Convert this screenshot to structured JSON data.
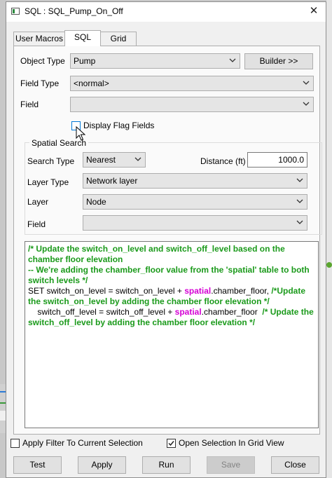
{
  "window": {
    "title": "SQL : SQL_Pump_On_Off"
  },
  "tabs": [
    {
      "label": "User Macros",
      "active": false
    },
    {
      "label": "SQL",
      "active": true
    },
    {
      "label": "Grid",
      "active": false
    }
  ],
  "form": {
    "object_type_label": "Object Type",
    "object_type_value": "Pump",
    "builder_label": "Builder >>",
    "field_type_label": "Field Type",
    "field_type_value": "<normal>",
    "field_label": "Field",
    "field_value": "",
    "display_flag_label": "Display Flag Fields",
    "display_flag_checked": false
  },
  "spatial": {
    "group_title": "Spatial Search",
    "search_type_label": "Search Type",
    "search_type_value": "Nearest",
    "distance_label": "Distance (ft)",
    "distance_value": "1000.0",
    "layer_type_label": "Layer Type",
    "layer_type_value": "Network layer",
    "layer_label": "Layer",
    "layer_value": "Node",
    "field_label": "Field",
    "field_value": ""
  },
  "sql": {
    "c1": "/*  Update the switch_on_level and switch_off_level based on the chamber floor elevation",
    "c2": "-- We're adding the chamber_floor value from the 'spatial' table to both switch levels */",
    "s1a": "SET switch_on_level = switch_on_level + ",
    "s1kw": "spatial",
    "s1b": ".chamber_floor, ",
    "s1c": "/*Update the switch_on_level by adding the chamber floor elevation */",
    "s2a": "    switch_off_level = switch_off_level + ",
    "s2kw": "spatial",
    "s2b": ".chamber_floor  ",
    "s2c": "/* Update the switch_off_level by adding the chamber floor elevation */"
  },
  "options": {
    "apply_filter_label": "Apply Filter To Current Selection",
    "apply_filter_checked": false,
    "open_selection_label": "Open Selection In Grid View",
    "open_selection_checked": true
  },
  "buttons": {
    "test": "Test",
    "apply": "Apply",
    "run": "Run",
    "save": "Save",
    "close": "Close"
  },
  "colors": {
    "comment": "#1b9a1b",
    "keyword": "#d400d4"
  }
}
